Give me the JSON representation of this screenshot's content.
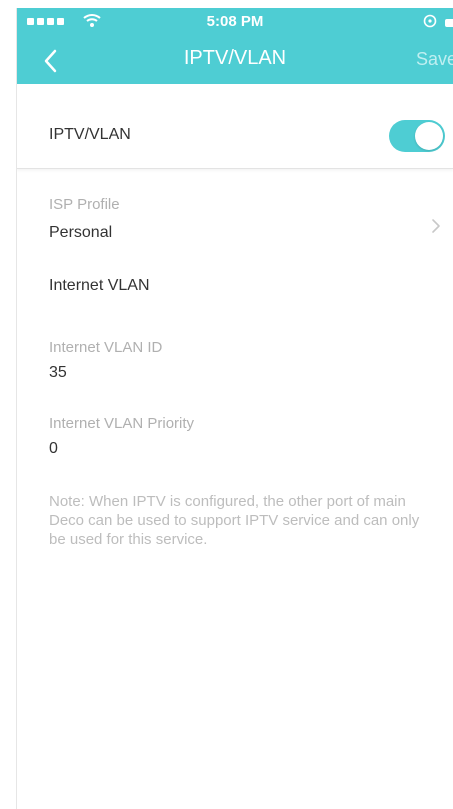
{
  "status_bar": {
    "time": "5:08 PM"
  },
  "nav": {
    "title": "IPTV/VLAN",
    "save_label": "Save",
    "back_icon": "chevron-left-icon"
  },
  "iptv_toggle": {
    "label": "IPTV/VLAN",
    "enabled": true
  },
  "isp_profile": {
    "label": "ISP Profile",
    "value": "Personal",
    "chevron_icon": "chevron-right-icon"
  },
  "internet_vlan": {
    "heading": "Internet VLAN",
    "vlan_id_label": "Internet VLAN ID",
    "vlan_id_value": "35",
    "priority_label": "Internet VLAN Priority",
    "priority_value": "0"
  },
  "note": "Note: When IPTV is configured, the other port of main Deco can be used to support IPTV service and can only be used for this service.",
  "colors": {
    "accent": "#4ecdd3",
    "text": "#333333",
    "muted": "#b0b0b0"
  }
}
